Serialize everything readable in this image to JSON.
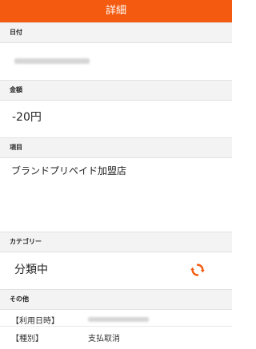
{
  "header": {
    "title": "詳細"
  },
  "sections": {
    "date": {
      "label": "日付"
    },
    "amount": {
      "label": "金額",
      "value": "-20円"
    },
    "item": {
      "label": "項目",
      "value": "ブランドプリペイド加盟店"
    },
    "category": {
      "label": "カテゴリー",
      "value": "分類中",
      "icon": "refresh-icon",
      "icon_color": "#f45b10"
    },
    "other": {
      "label": "その他",
      "rows": [
        {
          "key": "【利用日時】"
        },
        {
          "key": "【種別】",
          "value": "支払取消"
        }
      ]
    }
  },
  "colors": {
    "accent": "#f45b10",
    "section_bg": "#f3f3f3"
  }
}
